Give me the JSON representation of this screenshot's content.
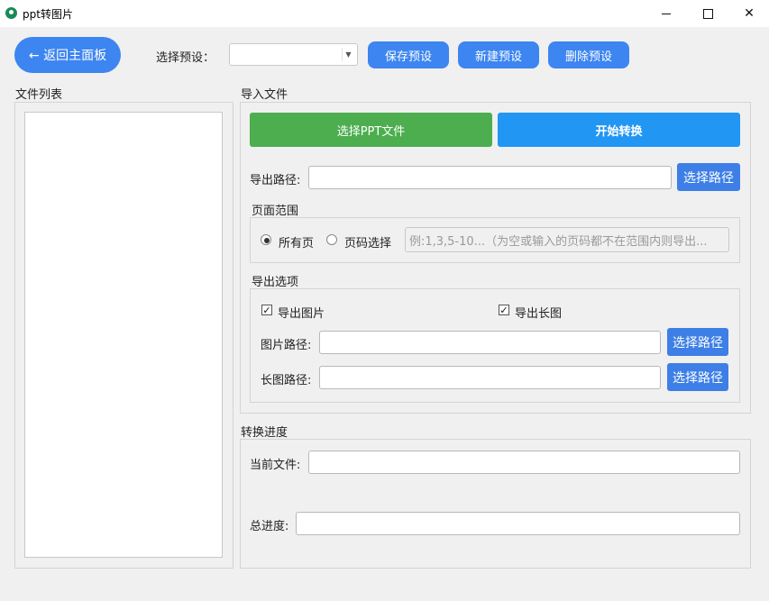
{
  "window": {
    "title": "ppt转图片",
    "minimize_glyph": "",
    "maximize_glyph": "",
    "close_glyph": "✕"
  },
  "toolbar": {
    "back_label": "← 返回主面板",
    "preset_label": "选择预设：",
    "preset_value": "",
    "save_preset_label": "保存预设",
    "new_preset_label": "新建预设",
    "delete_preset_label": "删除预设"
  },
  "file_list": {
    "title": "文件列表",
    "items": []
  },
  "import": {
    "title": "导入文件",
    "select_ppt_label": "选择PPT文件",
    "start_convert_label": "开始转换",
    "export_path_label": "导出路径:",
    "export_path_value": "",
    "select_path_label": "选择路径"
  },
  "page_range": {
    "title": "页面范围",
    "all_pages_label": "所有页",
    "all_pages_checked": true,
    "page_select_label": "页码选择",
    "page_select_checked": false,
    "input_placeholder": "例:1,3,5-10...（为空或输入的页码都不在范围内则导出..."
  },
  "export_options": {
    "title": "导出选项",
    "export_image_label": "导出图片",
    "export_image_checked": true,
    "export_long_label": "导出长图",
    "export_long_checked": true,
    "image_path_label": "图片路径:",
    "image_path_value": "",
    "long_path_label": "长图路径:",
    "long_path_value": "",
    "select_path_label": "选择路径"
  },
  "progress": {
    "title": "转换进度",
    "current_file_label": "当前文件:",
    "current_file_value": "",
    "total_progress_label": "总进度:",
    "total_progress_value": ""
  },
  "colors": {
    "accent_blue": "#3d85f0",
    "start_blue": "#2196f3",
    "select_green": "#4cae4f"
  }
}
